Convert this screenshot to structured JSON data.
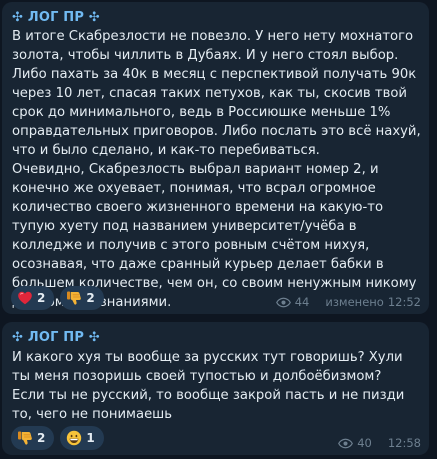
{
  "messages": [
    {
      "channel": "✣ ЛОГ ПР ✣",
      "paragraphs": [
        "В итоге Скабрезлости не повезло. У него нету мохнатого золота, чтобы чиллить в Дубаях. И у него стоял выбор. Либо пахать за 40к в месяц с перспективой получать 90к через 10 лет, спасая таких петухов, как ты, скосив твой срок до минимального, ведь в Россиюшке меньше 1% оправдательных приговоров. Либо послать это всё нахуй, что и было сделано, и как-то перебиваться.",
        "Очевидно, Скабрезлость выбрал вариант номер 2, и конечно же охуевает, понимая, что всрал огромное количество своего жизненного времени на какую-то тупую хуету под названием университет/учёба в колледже и получив с этого ровным счётом нихуя, осознавая, что даже сранный курьер делает бабки в большем количестве, чем он, со своим ненужным никому дипломом и знаниями."
      ],
      "reactions": [
        {
          "icon": "red-heart-icon",
          "count": "2"
        },
        {
          "icon": "thumbs-down-icon",
          "count": "2"
        }
      ],
      "views": "44",
      "edited_label": "изменено",
      "time": "12:52"
    },
    {
      "channel": "✣ ЛОГ ПР ✣",
      "paragraphs": [
        "И какого хуя ты вообще за русских тут говоришь? Хули ты меня позоришь своей тупостью и долбоёбизмом?",
        "Если ты не русский, то вообще закрой пасть и не пизди то, чего не понимаешь"
      ],
      "reactions": [
        {
          "icon": "thumbs-down-icon",
          "count": "2"
        },
        {
          "icon": "grinning-face-icon",
          "count": "1"
        }
      ],
      "views": "40",
      "edited_label": "",
      "time": "12:58"
    }
  ],
  "colors": {
    "background": "#0e1621",
    "bubble": "#182533",
    "channel_name": "#71baf2",
    "text": "#e4ecf2",
    "meta": "#6d7f8f",
    "reaction_bg": "#233a52"
  }
}
